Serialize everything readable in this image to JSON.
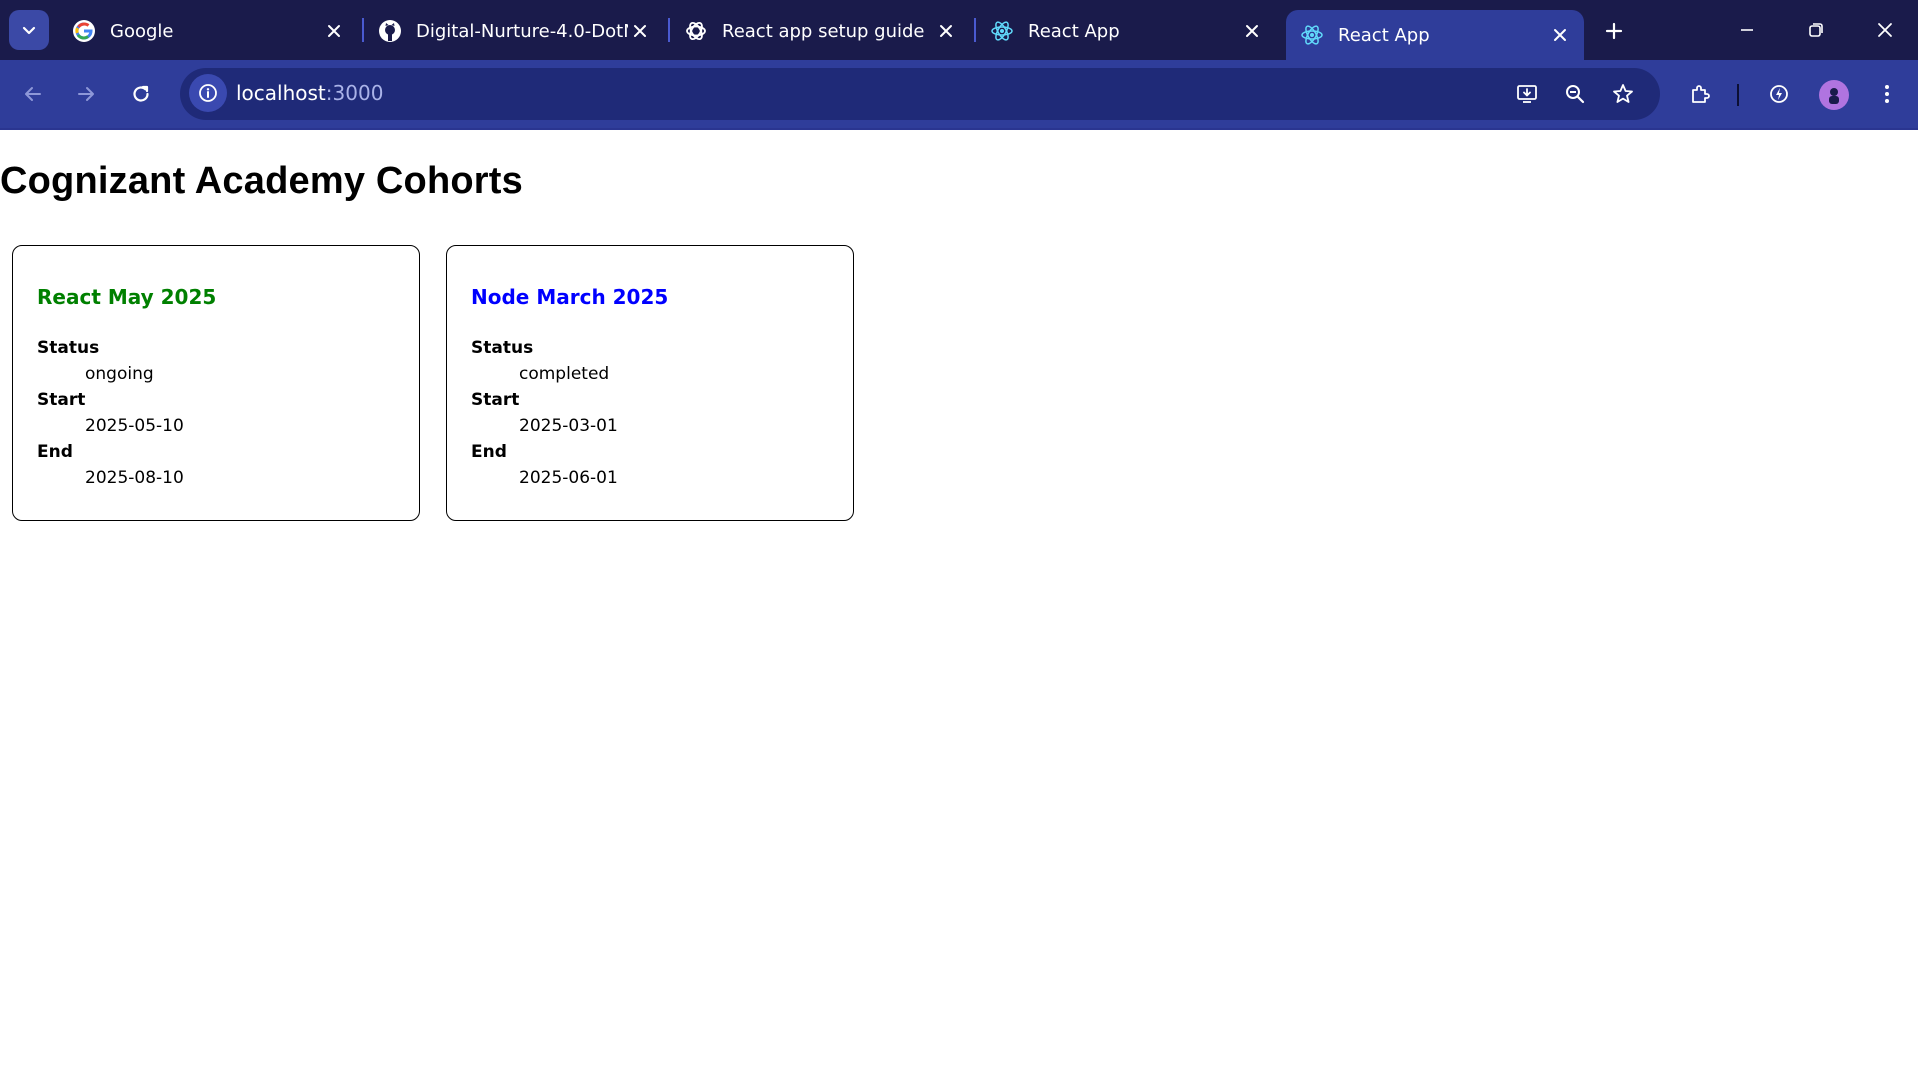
{
  "browser": {
    "tabs": [
      {
        "label": "Google",
        "icon": "google-icon"
      },
      {
        "label": "Digital-Nurture-4.0-DotN",
        "icon": "github-icon"
      },
      {
        "label": "React app setup guide",
        "icon": "chatgpt-icon"
      },
      {
        "label": "React App",
        "icon": "react-icon"
      },
      {
        "label": "React App",
        "icon": "react-icon",
        "active": true
      }
    ],
    "url": {
      "host": "localhost",
      "port": ":3000"
    },
    "colors": {
      "tabstrip": "#1a1b4b",
      "toolbar": "#2f3d9a",
      "omnibox": "#1f2a78"
    }
  },
  "page": {
    "title": "Cognizant Academy Cohorts",
    "cohorts": [
      {
        "name": "React May 2025",
        "name_color": "#008000",
        "status_label": "Status",
        "status": "ongoing",
        "start_label": "Start",
        "start": "2025-05-10",
        "end_label": "End",
        "end": "2025-08-10"
      },
      {
        "name": "Node March 2025",
        "name_color": "#0000ff",
        "status_label": "Status",
        "status": "completed",
        "start_label": "Start",
        "start": "2025-03-01",
        "end_label": "End",
        "end": "2025-06-01"
      }
    ]
  }
}
